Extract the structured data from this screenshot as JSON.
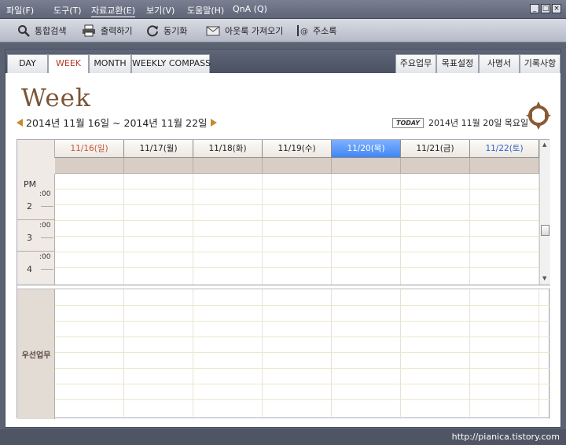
{
  "menu": {
    "items": [
      {
        "label": "파일(F)",
        "active": false
      },
      {
        "label": "도구(T)",
        "active": false
      },
      {
        "label": "자료교환(E)",
        "active": true
      },
      {
        "label": "보기(V)",
        "active": false
      },
      {
        "label": "도움말(H)",
        "active": false
      },
      {
        "label": "QnA (Q)",
        "active": false
      }
    ],
    "window_buttons": [
      "_",
      "□",
      "×"
    ]
  },
  "toolbar": {
    "items": [
      {
        "label": "통합검색",
        "icon": "magnifier-icon"
      },
      {
        "label": "출력하기",
        "icon": "printer-icon"
      },
      {
        "label": "동기화",
        "icon": "sync-icon"
      },
      {
        "label": "아웃룩 가져오기",
        "icon": "envelope-icon"
      },
      {
        "label": "주소록",
        "icon": "address-book-icon"
      }
    ]
  },
  "tabs": {
    "left": [
      {
        "label": "DAY",
        "active": false
      },
      {
        "label": "WEEK",
        "active": true
      },
      {
        "label": "MONTH",
        "active": false
      },
      {
        "label": "WEEKLY COMPASS",
        "active": false
      }
    ],
    "right": [
      {
        "label": "주요업무"
      },
      {
        "label": "목표설정"
      },
      {
        "label": "사명서"
      },
      {
        "label": "기록사항"
      }
    ]
  },
  "week": {
    "title": "Week",
    "range": "2014년 11월 16일 ~ 2014년 11월 22일",
    "today_badge": "TODAY",
    "today_date": "2014년 11월 20일 목요일"
  },
  "calendar": {
    "days": [
      {
        "label": "11/16(일)",
        "kind": "sun"
      },
      {
        "label": "11/17(월)",
        "kind": "weekday"
      },
      {
        "label": "11/18(화)",
        "kind": "weekday"
      },
      {
        "label": "11/19(수)",
        "kind": "weekday"
      },
      {
        "label": "11/20(목)",
        "kind": "today"
      },
      {
        "label": "11/21(금)",
        "kind": "weekday"
      },
      {
        "label": "11/22(토)",
        "kind": "sat"
      }
    ],
    "period_label": "PM",
    "hours": [
      {
        "num": "2",
        "min": ":00"
      },
      {
        "num": "3",
        "min": ":00"
      },
      {
        "num": "4",
        "min": ":00"
      }
    ],
    "priority_label": "우선업무"
  },
  "colors": {
    "today_header": "#3f86f5",
    "sunday_text": "#c0593a",
    "saturday_text": "#2f62c9",
    "active_tab_text": "#b83a2b",
    "title_color": "#7a5538"
  },
  "status": {
    "url": "http://pianica.tistory.com"
  }
}
